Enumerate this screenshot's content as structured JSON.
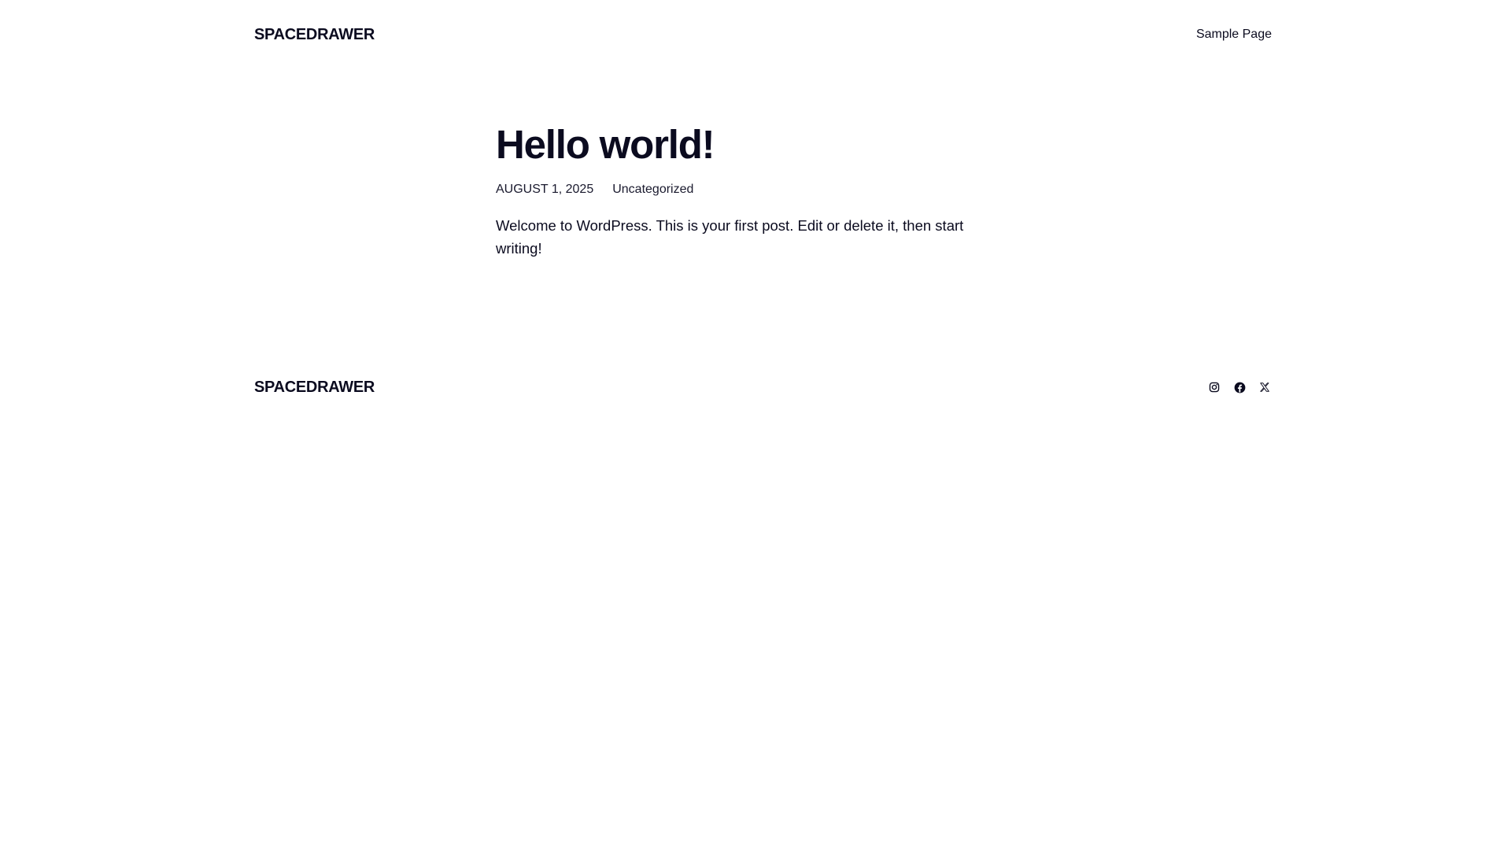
{
  "header": {
    "site_title": "SPACEDRAWER",
    "nav": [
      {
        "label": "Sample Page"
      }
    ]
  },
  "post": {
    "title": "Hello world!",
    "date": "AUGUST 1, 2025",
    "category": "Uncategorized",
    "content": "Welcome to WordPress. This is your first post. Edit or delete it, then start writing!"
  },
  "footer": {
    "site_title": "SPACEDRAWER",
    "social_icons": [
      "instagram-icon",
      "facebook-icon",
      "x-icon"
    ]
  },
  "colors": {
    "text": "#0b0b1f",
    "background": "#ffffff"
  }
}
